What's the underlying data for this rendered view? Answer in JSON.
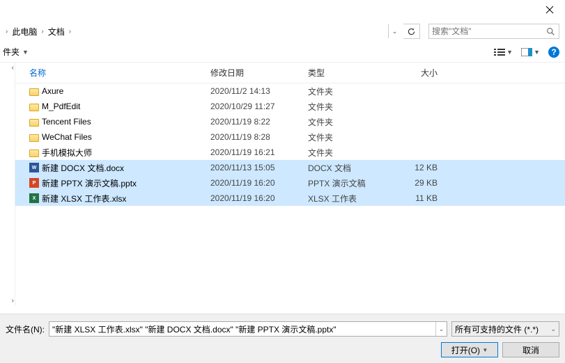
{
  "breadcrumb": {
    "pc": "此电脑",
    "docs": "文档"
  },
  "search": {
    "placeholder": "搜索\"文档\""
  },
  "toolbar": {
    "folder_label": "件夹"
  },
  "columns": {
    "name": "名称",
    "date": "修改日期",
    "type": "类型",
    "size": "大小"
  },
  "rows": [
    {
      "icon": "folder",
      "name": "Axure",
      "date": "2020/11/2 14:13",
      "type": "文件夹",
      "size": "",
      "sel": false
    },
    {
      "icon": "folder",
      "name": "M_PdfEdit",
      "date": "2020/10/29 11:27",
      "type": "文件夹",
      "size": "",
      "sel": false
    },
    {
      "icon": "folder",
      "name": "Tencent Files",
      "date": "2020/11/19 8:22",
      "type": "文件夹",
      "size": "",
      "sel": false
    },
    {
      "icon": "folder",
      "name": "WeChat Files",
      "date": "2020/11/19 8:28",
      "type": "文件夹",
      "size": "",
      "sel": false
    },
    {
      "icon": "folder",
      "name": "手机模拟大师",
      "date": "2020/11/19 16:21",
      "type": "文件夹",
      "size": "",
      "sel": false
    },
    {
      "icon": "docx",
      "name": "新建 DOCX 文档.docx",
      "date": "2020/11/13 15:05",
      "type": "DOCX 文档",
      "size": "12 KB",
      "sel": true
    },
    {
      "icon": "pptx",
      "name": "新建 PPTX 演示文稿.pptx",
      "date": "2020/11/19 16:20",
      "type": "PPTX 演示文稿",
      "size": "29 KB",
      "sel": true
    },
    {
      "icon": "xlsx",
      "name": "新建 XLSX 工作表.xlsx",
      "date": "2020/11/19 16:20",
      "type": "XLSX 工作表",
      "size": "11 KB",
      "sel": true
    }
  ],
  "filename": {
    "label": "文件名(N):",
    "value": "\"新建 XLSX 工作表.xlsx\" \"新建 DOCX 文档.docx\" \"新建 PPTX 演示文稿.pptx\""
  },
  "filter": {
    "label": "所有可支持的文件 (*.*)"
  },
  "buttons": {
    "open": "打开(O)",
    "cancel": "取消"
  }
}
